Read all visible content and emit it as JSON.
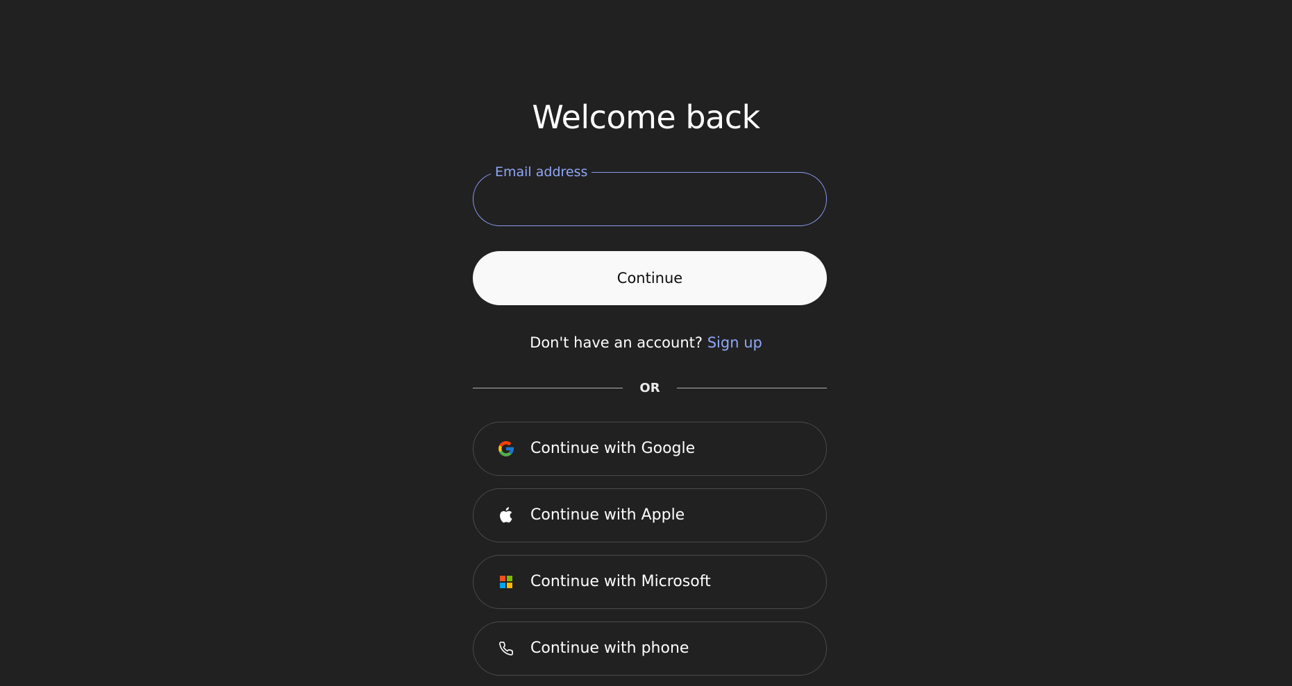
{
  "page": {
    "title": "Welcome back"
  },
  "email": {
    "label": "Email address",
    "value": "",
    "accent_color": "#8b9cf4"
  },
  "continue_button": {
    "label": "Continue"
  },
  "signup": {
    "prompt": "Don't have an account?",
    "link_label": "Sign up"
  },
  "divider": {
    "label": "OR"
  },
  "providers": [
    {
      "label": "Continue with Google",
      "icon": "google-icon"
    },
    {
      "label": "Continue with Apple",
      "icon": "apple-icon"
    },
    {
      "label": "Continue with Microsoft",
      "icon": "microsoft-icon"
    },
    {
      "label": "Continue with phone",
      "icon": "phone-icon"
    }
  ],
  "colors": {
    "background": "#212121",
    "link": "#8fa8f8",
    "button_bg": "#f9f9f9"
  }
}
